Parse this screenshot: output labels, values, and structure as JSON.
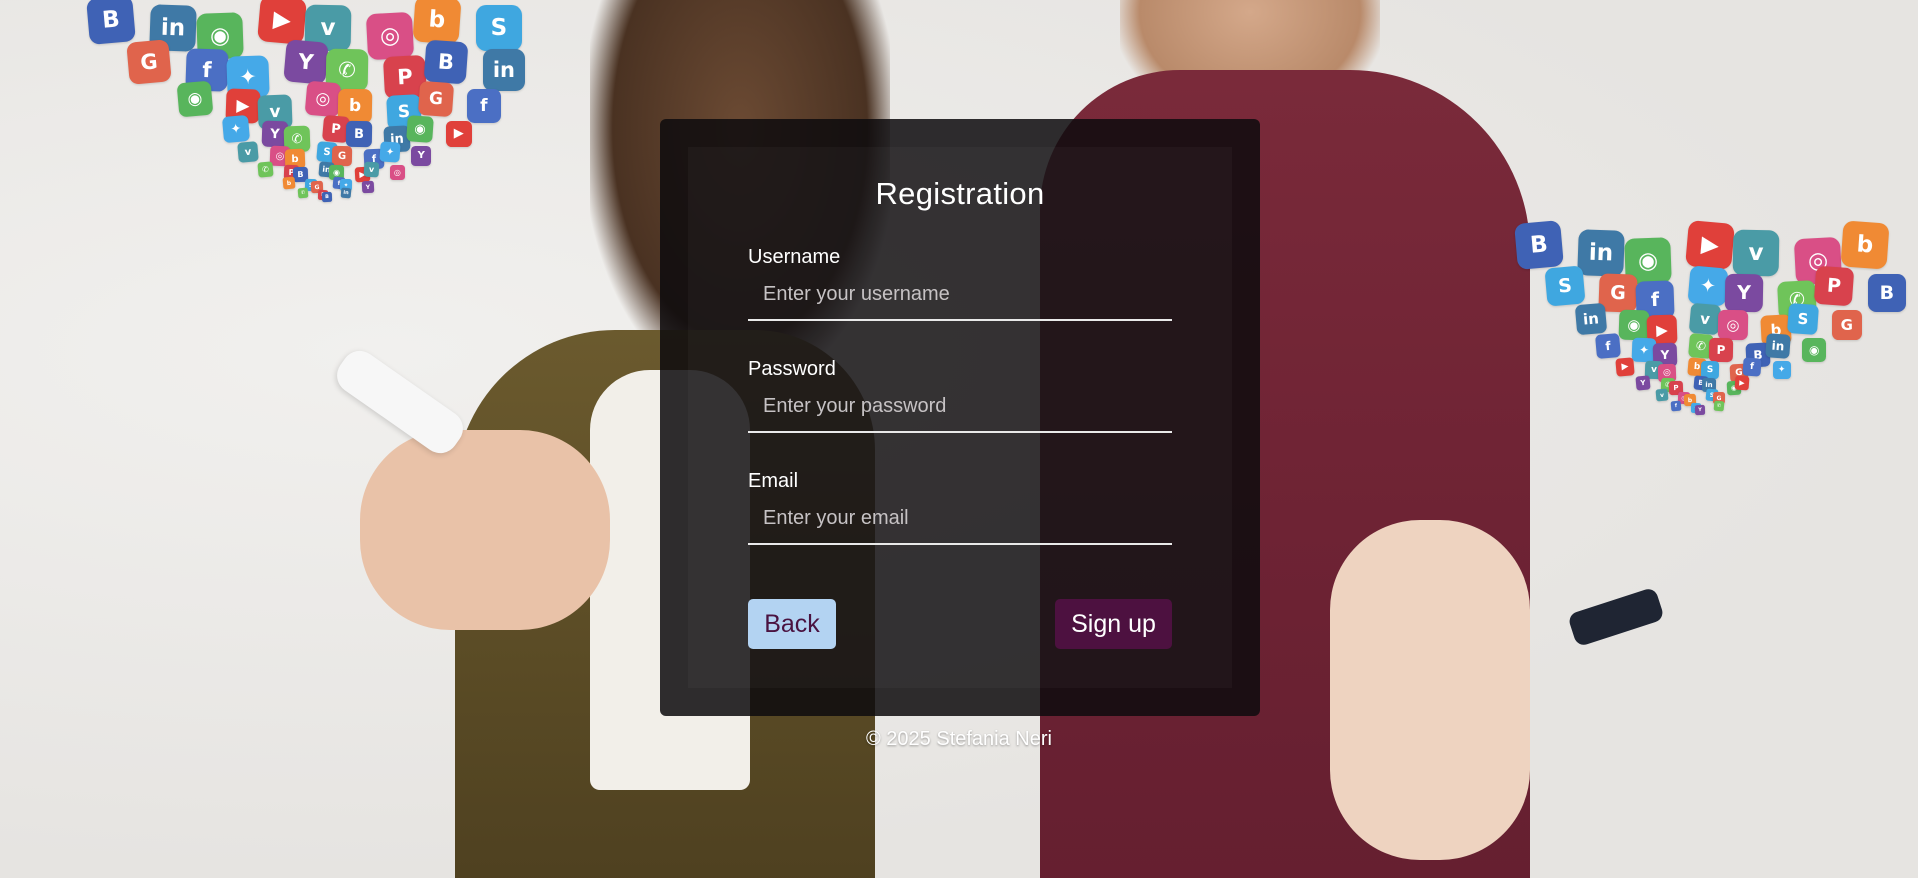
{
  "form": {
    "title": "Registration",
    "username": {
      "label": "Username",
      "placeholder": "Enter your username",
      "value": ""
    },
    "password": {
      "label": "Password",
      "placeholder": "Enter your password",
      "value": ""
    },
    "email": {
      "label": "Email",
      "placeholder": "Enter your email",
      "value": ""
    },
    "back_label": "Back",
    "signup_label": "Sign up"
  },
  "footer": {
    "text": "© 2025 Stefania Neri"
  },
  "colors": {
    "card_background": "#0e0c0e",
    "back_button": "#b3d3f2",
    "signup_button": "#4d1140",
    "input_underline": "#e9e9e9"
  },
  "background": {
    "icon_names": [
      "instagram-icon",
      "google-plus-icon",
      "yahoo-icon",
      "behance-icon",
      "youtube-icon",
      "blogger-icon",
      "facebook-icon",
      "whatsapp-icon",
      "linkedin-icon",
      "vimeo-icon",
      "skype-icon",
      "twitter-icon",
      "pinterest-icon",
      "line-icon"
    ]
  }
}
